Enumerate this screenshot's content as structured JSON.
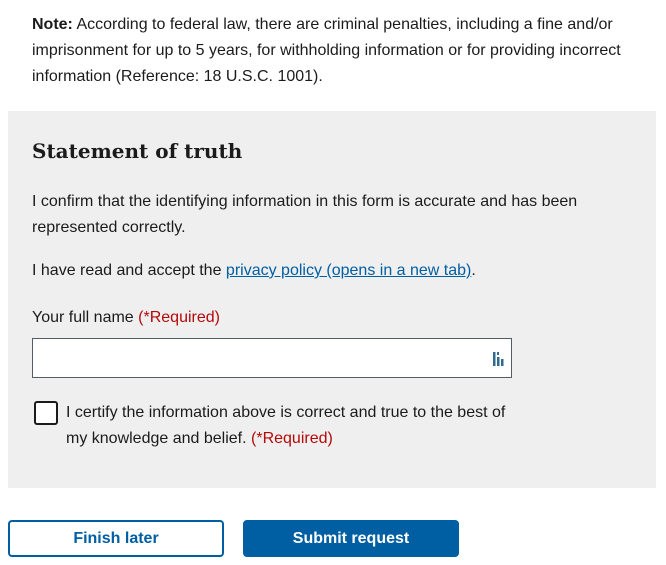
{
  "note": {
    "label": "Note:",
    "text": " According to federal law, there are criminal penalties, including a fine and/or imprisonment for up to 5 years, for withholding information or for providing incorrect information (Reference: 18 U.S.C. 1001)."
  },
  "statement": {
    "title": "Statement of truth",
    "confirm_text": "I confirm that the identifying information in this form is accurate and has been represented correctly.",
    "privacy_prefix": "I have read and accept the ",
    "privacy_link": "privacy policy (opens in a new tab)",
    "privacy_suffix": ".",
    "name_label": "Your full name",
    "name_required": "(*Required)",
    "name_value": "",
    "name_placeholder": "",
    "certify_text": "I certify the information above is correct and true to the best of my knowledge and belief.",
    "certify_required": "(*Required)"
  },
  "buttons": {
    "finish_later": "Finish later",
    "submit": "Submit request"
  },
  "colors": {
    "primary": "#005ea2",
    "required": "#b50909",
    "panel_bg": "#efefef"
  }
}
